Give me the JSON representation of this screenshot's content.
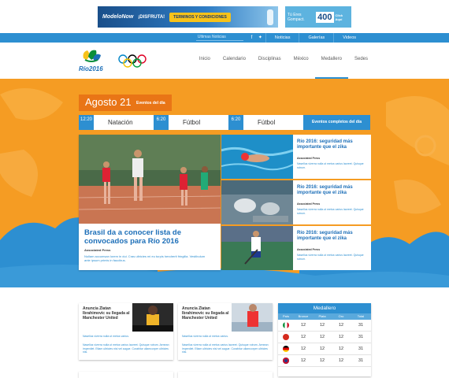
{
  "ads": {
    "ad1": {
      "brand": "ModeloNow",
      "slogan": "¡DISFRUTA!",
      "cta": "TERMINOS Y CONDICIONES"
    },
    "ad2": {
      "text": "Gompact",
      "number": "400",
      "click": "Click Aquí",
      "brand": "Tú Eres Gompact."
    }
  },
  "topbar": {
    "search_placeholder": "Ultimas Noticias",
    "links": [
      "Noticias",
      "Galerías",
      "Videos"
    ]
  },
  "header": {
    "logo_text": "Río2016",
    "nav": [
      "Inicio",
      "Calendario",
      "Disciplinas",
      "México",
      "Medallero",
      "Sedes"
    ],
    "active_nav": "Medallero"
  },
  "hero": {
    "date": "Agosto 21",
    "date_label": "Eventos del día",
    "events": [
      {
        "time": "12:20",
        "sport": "Natación"
      },
      {
        "time": "6:20",
        "sport": "Fútbol"
      },
      {
        "time": "6:20",
        "sport": "Fútbol"
      }
    ],
    "events_button": "Eventos completos del día",
    "main": {
      "title": "Brasil da a conocer lista de convocados para Río 2016",
      "byline": "Associated Press",
      "excerpt": "Nullam accumsan lorem in dui. Cras ultricies mi eu turpis hendrerit fringilla. Vestibulum ante ipsum primis in faucibus."
    },
    "side": [
      {
        "title": "Río 2016: seguridad más importante que el zika",
        "byline": "Associated Press",
        "excerpt": "Nasellus viverra nulla ut metus varius laoreet. Quisque rutrum."
      },
      {
        "title": "Río 2016: seguridad más importante que el zika",
        "byline": "Associated Press",
        "excerpt": "Nasellus viverra nulla ut metus varius laoreet. Quisque rutrum."
      },
      {
        "title": "Río 2016: seguridad más importante que el zika",
        "byline": "Associated Press",
        "excerpt": "Nasellus viverra nulla ut metus varius laoreet. Quisque rutrum."
      }
    ]
  },
  "news": [
    {
      "title": "Anuncia Zlatan Ibrahimovic su llegada al Manchester United",
      "ex1": "Nasellus viverra nulla ut metus varius.",
      "ex2": "Nasellus viverra nulla ut metus varius laoreet. Quisque rutrum. Aenean imperdiet. Etiam ultricies nisi vel augue. Curabitur ullamcorper ultricies nisi."
    },
    {
      "title": "Anuncia Zlatan Ibrahimovic su llegada al Manchester United",
      "ex1": "Nasellus viverra nulla ut metus varius.",
      "ex2": "Nasellus viverra nulla ut metus varius laoreet. Quisque rutrum. Aenean imperdiet. Etiam ultricies nisi vel augue. Curabitur ullamcorper ultricies nisi."
    }
  ],
  "medallero": {
    "title": "Medallero",
    "columns": [
      "País",
      "Bronce",
      "Plata",
      "Oro",
      "Total"
    ],
    "rows": [
      {
        "flag": "#0b8f3a",
        "bronce": "12",
        "plata": "12",
        "oro": "12",
        "total": "31"
      },
      {
        "flag": "#d52b1e",
        "bronce": "12",
        "plata": "12",
        "oro": "12",
        "total": "31"
      },
      {
        "flag": "#000000",
        "bronce": "12",
        "plata": "12",
        "oro": "12",
        "total": "31"
      },
      {
        "flag": "#1d3a8f",
        "bronce": "12",
        "plata": "12",
        "oro": "12",
        "total": "31"
      }
    ]
  },
  "colors": {
    "brand_blue": "#2d8fd1",
    "orange": "#f59c23"
  }
}
